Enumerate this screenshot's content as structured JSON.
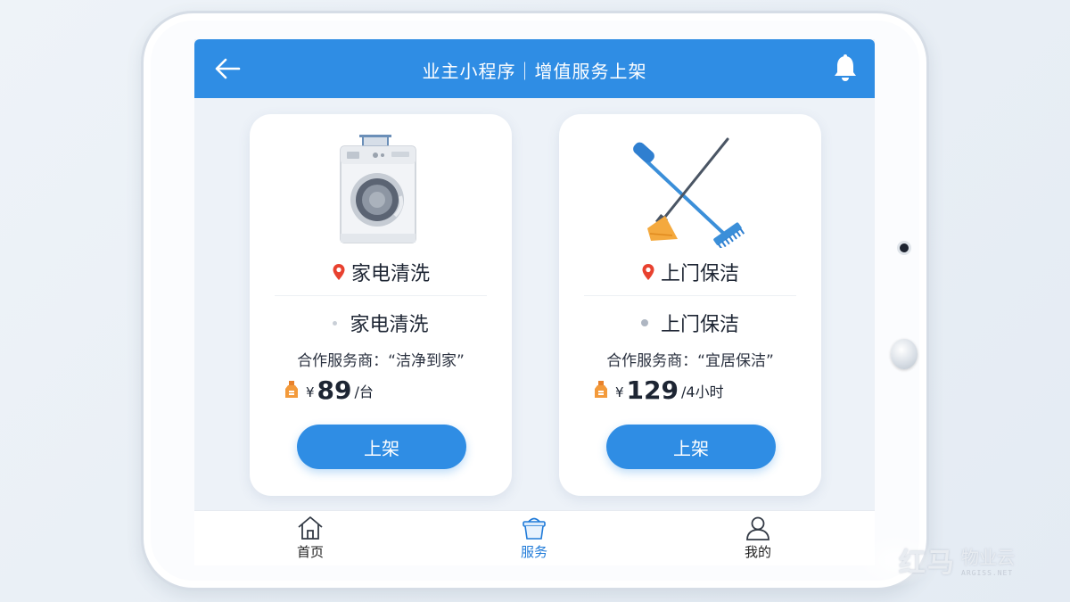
{
  "header": {
    "title": "业主小程序｜增值服务上架",
    "back_icon": "arrow-left-icon",
    "bell_icon": "bell-icon",
    "bg_color": "#2f8de4"
  },
  "services": [
    {
      "illustration": "washing-machine-icon",
      "heading": "家电清洗",
      "name": "家电清洗",
      "partner": "合作服务商：“洁净到家”",
      "currency": "¥",
      "price": "89",
      "unit": "/台",
      "button": "上架"
    },
    {
      "illustration": "broom-and-mop-icon",
      "heading": "上门保洁",
      "name": "上门保洁",
      "partner": "合作服务商：“宜居保洁”",
      "currency": "¥",
      "price": "129",
      "unit": "/4小时",
      "button": "上架"
    }
  ],
  "tabbar": {
    "active": "服务",
    "items": [
      {
        "label": "首页",
        "icon": "home-icon"
      },
      {
        "label": "服务",
        "icon": "basket-icon"
      },
      {
        "label": "我的",
        "icon": "user-icon"
      }
    ]
  },
  "watermark": {
    "main": "红马",
    "side_top": "物业云",
    "side_bottom": "ARGISS.NET"
  },
  "accent_color": "#2f8de4"
}
